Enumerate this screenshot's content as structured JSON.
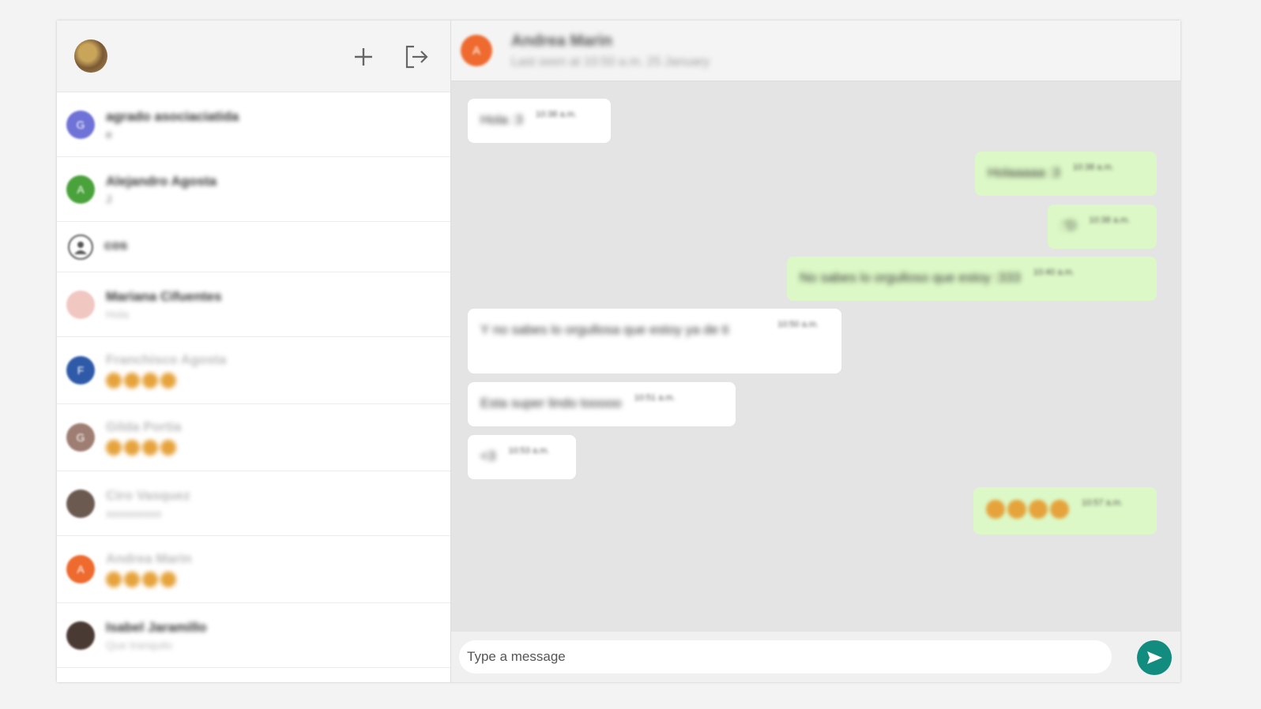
{
  "sidebar": {
    "header": {
      "avatar_icon": "profile-avatar",
      "new_chat_icon": "plus-icon",
      "logout_icon": "logout-icon"
    },
    "chats": [
      {
        "initial": "G",
        "name": "agrado asociaciatida",
        "last": "e",
        "color": "#6f72d6",
        "type": "text"
      },
      {
        "initial": "A",
        "name": "Alejandro Agosta",
        "last": "J",
        "color": "#4aa23b",
        "type": "text"
      },
      {
        "initial": "",
        "name": "cos",
        "last": "",
        "color": "#ffffff",
        "type": "person"
      },
      {
        "initial": "",
        "name": "Mariana Cifuentes",
        "last": "Hola",
        "color": "#f1c7c1",
        "type": "faint"
      },
      {
        "initial": "F",
        "name": "Franchisco Agosta",
        "last": "",
        "color": "#2f5aa8",
        "type": "emoji"
      },
      {
        "initial": "G",
        "name": "Gilda Portia",
        "last": "",
        "color": "#9e7d72",
        "type": "emoji"
      },
      {
        "initial": "",
        "name": "Ciro Vasquez",
        "last": "aaaaaaaaa",
        "color": "#6b5a50",
        "type": "faint"
      },
      {
        "initial": "A",
        "name": "Andrea Marin",
        "last": "",
        "color": "#ee6a2e",
        "type": "emoji"
      },
      {
        "initial": "",
        "name": "Isabel Jaramillo",
        "last": "Que tranquilo",
        "color": "#4a3a34",
        "type": "text"
      }
    ]
  },
  "conversation": {
    "contact_initial": "A",
    "contact_name": "Andrea Marin",
    "contact_status": "Last seen at 10:50 a.m. 25 January",
    "messages": [
      {
        "dir": "in",
        "text": "Hola :3",
        "time": "10:38 a.m."
      },
      {
        "dir": "out",
        "text": "Holaaaaa :3",
        "time": "10:38 a.m."
      },
      {
        "dir": "out",
        "text": ":'D",
        "time": "10:38 a.m."
      },
      {
        "dir": "out",
        "text": "No sabes lo orgulloso que estoy :333",
        "time": "10:40 a.m."
      },
      {
        "dir": "in",
        "text": "Y no sabes lo orgullosa que estoy ya de ti",
        "time": "10:50 a.m."
      },
      {
        "dir": "in",
        "text": "Esta super lindo tooooo",
        "time": "10:51 a.m."
      },
      {
        "dir": "in",
        "text": "<3",
        "time": "10:53 a.m."
      },
      {
        "dir": "out",
        "text": "",
        "time": "10:57 a.m."
      }
    ]
  },
  "composer": {
    "placeholder": "Type a message",
    "value": "",
    "send_icon": "send-icon"
  },
  "colors": {
    "accent": "#128c7e",
    "incoming_bubble": "#ffffff",
    "outgoing_bubble": "#dcf8c6",
    "chat_background": "#e4e4e4"
  }
}
